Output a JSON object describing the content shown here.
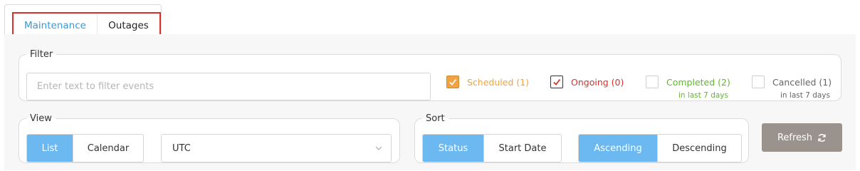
{
  "tabs": [
    {
      "label": "Maintenance",
      "active": true
    },
    {
      "label": "Outages",
      "active": false
    }
  ],
  "filter": {
    "legend": "Filter",
    "input_placeholder": "Enter text to filter events",
    "input_value": "",
    "checkboxes": [
      {
        "label": "Scheduled (1)",
        "checked": true,
        "color": "#f0a340",
        "sub": ""
      },
      {
        "label": "Ongoing (0)",
        "checked": true,
        "color": "#d9302c",
        "sub": ""
      },
      {
        "label": "Completed (2)",
        "checked": false,
        "color": "#62b62f",
        "sub": "in last 7 days"
      },
      {
        "label": "Cancelled (1)",
        "checked": false,
        "color": "#666666",
        "sub": "in last 7 days"
      }
    ]
  },
  "view": {
    "legend": "View",
    "options": [
      "List",
      "Calendar"
    ],
    "selected": "List",
    "timezone": "UTC"
  },
  "sort": {
    "legend": "Sort",
    "fields": [
      "Status",
      "Start Date"
    ],
    "selected_field": "Status",
    "orders": [
      "Ascending",
      "Descending"
    ],
    "selected_order": "Ascending"
  },
  "refresh": {
    "label": "Refresh",
    "icon": "refresh-icon"
  },
  "colors": {
    "accent": "#6cb8f0",
    "tab_active": "#2f9be0",
    "highlight_border": "#d9302c",
    "refresh_bg": "#9a938d"
  }
}
